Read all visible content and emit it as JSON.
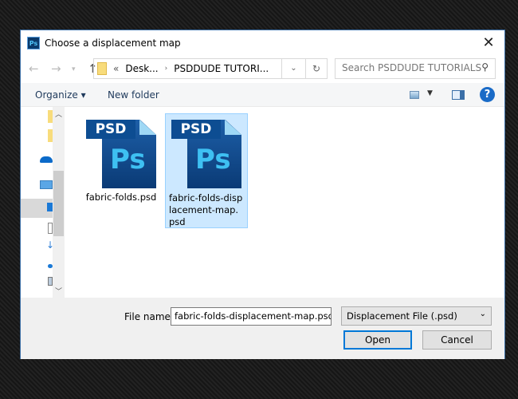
{
  "title": "Choose a displacement map",
  "app_icon": "Ps",
  "address": {
    "prefix": "«",
    "crumbs": [
      "Desk...",
      "PSDDUDE TUTORI..."
    ]
  },
  "search_placeholder": "Search PSDDUDE TUTORIALS",
  "toolbar": {
    "organize": "Organize ▾",
    "new_folder": "New folder"
  },
  "files": [
    {
      "name": "fabric-folds.psd",
      "badge": "PSD",
      "logo": "Ps",
      "selected": false
    },
    {
      "name": "fabric-folds-displacement-map.psd",
      "badge": "PSD",
      "logo": "Ps",
      "selected": true
    }
  ],
  "bottom": {
    "file_name_label": "File name:",
    "file_name_value": "fabric-folds-displacement-map.psd",
    "file_type": "Displacement File (.psd)",
    "open": "Open",
    "cancel": "Cancel"
  }
}
